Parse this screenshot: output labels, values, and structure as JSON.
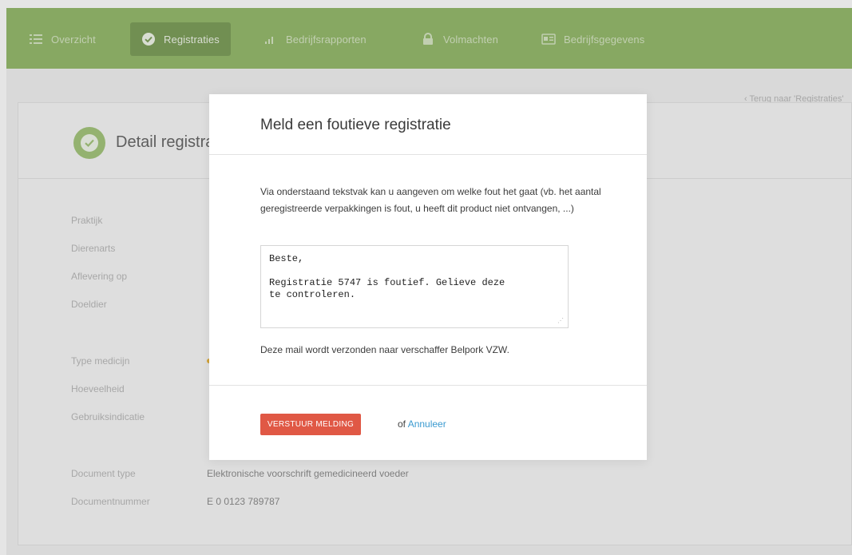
{
  "nav": {
    "items": [
      {
        "label": "Overzicht",
        "icon": "list-icon",
        "active": false
      },
      {
        "label": "Registraties",
        "icon": "check-circle-icon",
        "active": true
      },
      {
        "label": "Bedrijfsrapporten",
        "icon": "bar-chart-icon",
        "active": false
      },
      {
        "label": "Volmachten",
        "icon": "lock-icon",
        "active": false
      },
      {
        "label": "Bedrijfsgegevens",
        "icon": "id-card-icon",
        "active": false
      }
    ]
  },
  "back_link": "Terug naar 'Registraties'",
  "detail": {
    "title": "Detail registratie",
    "rows": [
      {
        "label": "Praktijk"
      },
      {
        "label": "Dierenarts"
      },
      {
        "label": "Aflevering op"
      },
      {
        "label": "Doeldier"
      },
      {
        "label": "Type medicijn"
      },
      {
        "label": "Hoeveelheid"
      },
      {
        "label": "Gebruiksindicatie"
      },
      {
        "label": "Document type",
        "value": "Elektronische voorschrift gemedicineerd voeder"
      },
      {
        "label": "Documentnummer",
        "value": "E 0 0123 789787"
      }
    ]
  },
  "modal": {
    "title": "Meld een foutieve registratie",
    "description": "Via onderstaand tekstvak kan u aangeven om welke fout het gaat (vb. het aantal geregistreerde verpakkingen is fout, u heeft dit product niet ontvangen, ...)",
    "textarea_value": "Beste,\n\nRegistratie 5747 is foutief. Gelieve deze\nte controleren.",
    "note": "Deze mail wordt verzonden naar verschaffer Belpork VZW.",
    "send_button": "VERSTUUR MELDING",
    "or_text": "of",
    "cancel_link": "Annuleer"
  },
  "colors": {
    "nav_bg": "#94ba6a",
    "nav_active": "#7c9e58",
    "send_button": "#e05845",
    "link": "#3a9ad0"
  }
}
